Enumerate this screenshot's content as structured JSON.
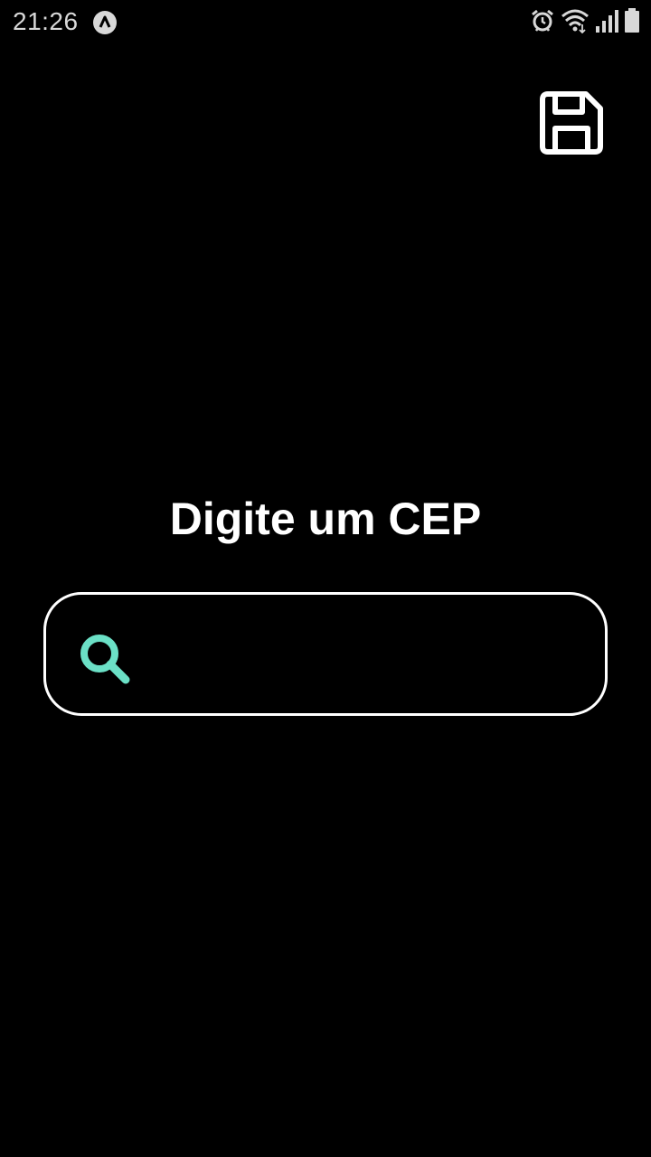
{
  "status_bar": {
    "time": "21:26",
    "app_icon": "app-notification-icon",
    "icons": [
      "alarm-icon",
      "wifi-icon",
      "signal-icon",
      "battery-icon"
    ]
  },
  "header": {
    "save_icon": "floppy-disk-icon"
  },
  "main": {
    "title": "Digite um CEP",
    "search": {
      "value": "",
      "placeholder": "",
      "icon": "search-icon",
      "icon_color": "#6be0c6",
      "border_color": "#ffffff"
    }
  },
  "colors": {
    "background": "#000000",
    "text": "#ffffff",
    "accent": "#6be0c6"
  }
}
